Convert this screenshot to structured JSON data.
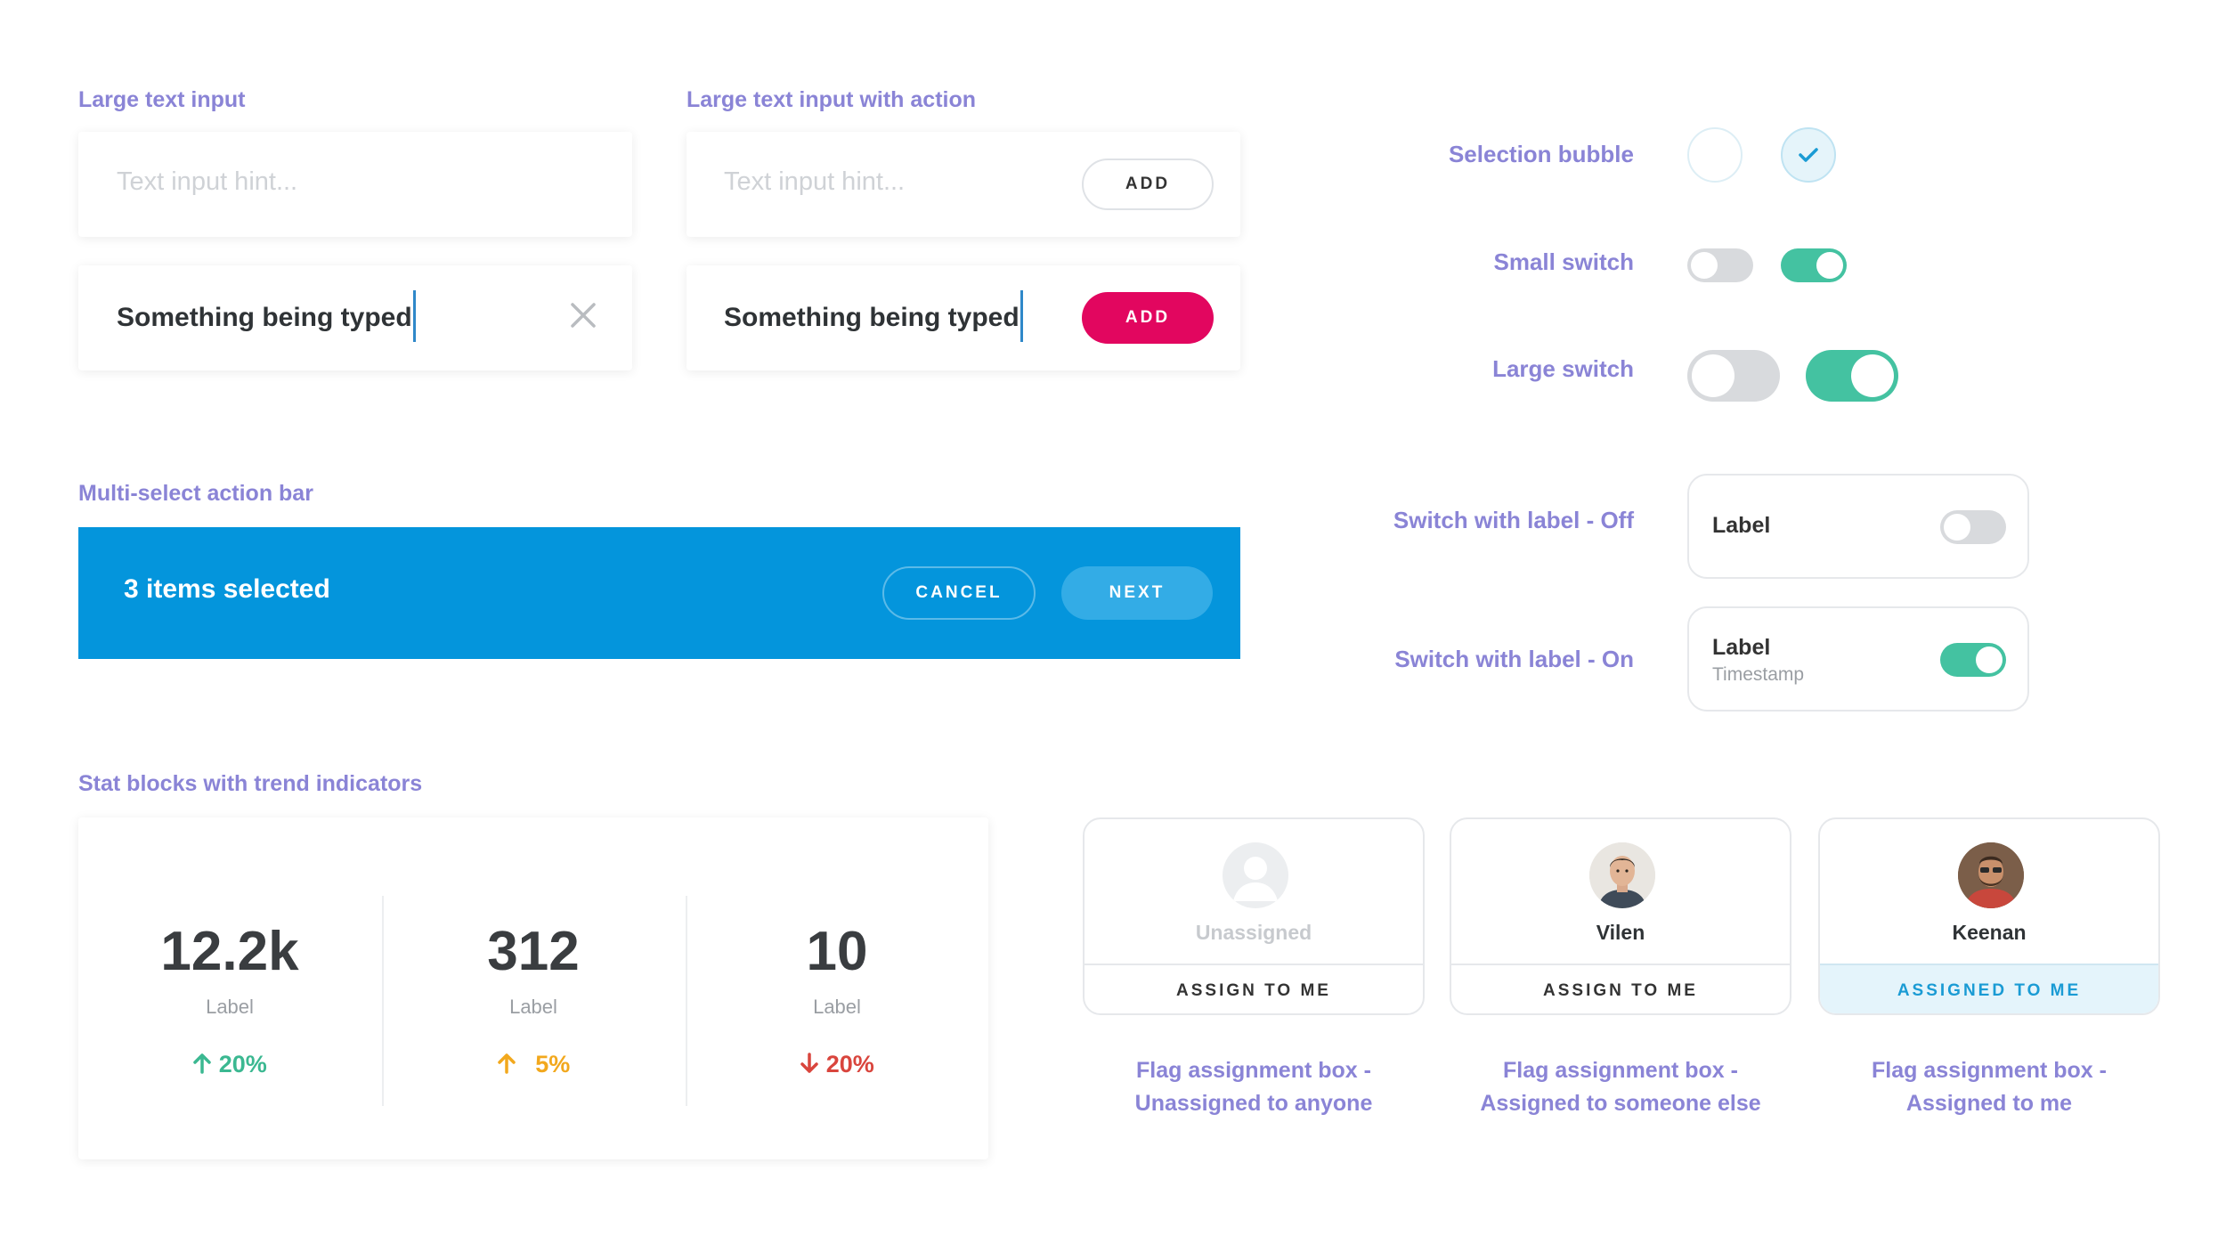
{
  "sections": {
    "large_text_input": "Large text input",
    "large_text_input_action": "Large text input with action",
    "multi_select": "Multi-select action bar",
    "stat_blocks": "Stat blocks with trend indicators"
  },
  "inputs": {
    "hint": "Text input hint...",
    "typed_value": "Something being typed",
    "add_label": "ADD"
  },
  "controls": {
    "selection_bubble": "Selection bubble",
    "small_switch": "Small switch",
    "large_switch": "Large switch",
    "switch_label_off": "Switch with label - Off",
    "switch_label_on": "Switch with label - On",
    "box_label": "Label",
    "box_timestamp": "Timestamp"
  },
  "action_bar": {
    "selected_text": "3 items selected",
    "cancel": "CANCEL",
    "next": "NEXT"
  },
  "stats": [
    {
      "value": "12.2k",
      "label": "Label",
      "trend": "20%",
      "direction": "up",
      "color": "#3bb891"
    },
    {
      "value": "312",
      "label": "Label",
      "trend": "5%",
      "direction": "up",
      "color": "#f2a81d"
    },
    {
      "value": "10",
      "label": "Label",
      "trend": "20%",
      "direction": "down",
      "color": "#d9453d"
    }
  ],
  "flags": [
    {
      "name": "Unassigned",
      "action": "ASSIGN TO ME",
      "caption_line1": "Flag assignment box -",
      "caption_line2": "Unassigned to anyone"
    },
    {
      "name": "Vilen",
      "action": "ASSIGN TO ME",
      "caption_line1": "Flag assignment box -",
      "caption_line2": "Assigned to someone else"
    },
    {
      "name": "Keenan",
      "action": "ASSIGNED TO ME",
      "caption_line1": "Flag assignment box -",
      "caption_line2": "Assigned to me"
    }
  ],
  "colors": {
    "accent_purple": "#8a84d6",
    "action_bar_blue": "#0495dc",
    "add_pink": "#e2065f",
    "switch_on": "#44c2a1",
    "assigned_bg": "#e4f4fb",
    "assigned_text": "#1a9bd4"
  }
}
